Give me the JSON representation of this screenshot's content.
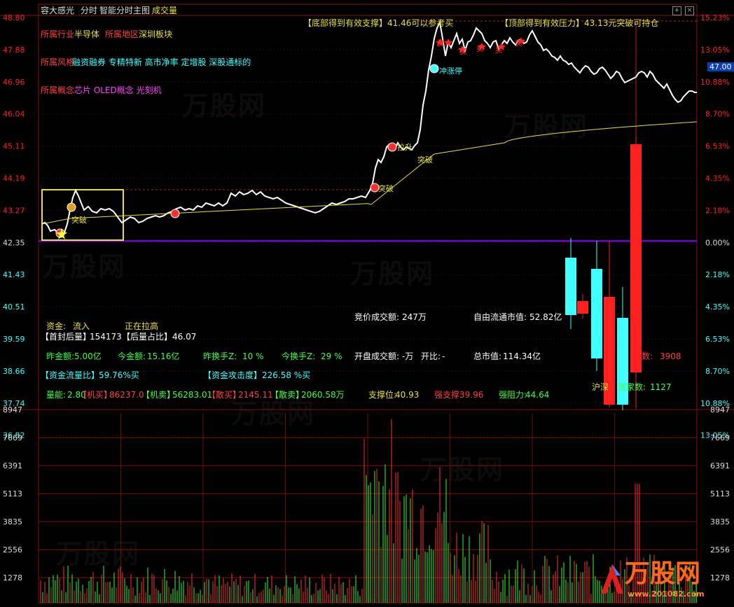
{
  "header": {
    "stock_name": "容大感光",
    "mode": "分时",
    "main_chart": "智能分时主图",
    "indicator": "成交量",
    "btn_add": "+",
    "btn_close": "×"
  },
  "y_price": [
    "48.80",
    "47.88",
    "46.96",
    "46.04",
    "45.11",
    "44.19",
    "43.27",
    "42.35",
    "41.43",
    "40.51",
    "39.59",
    "38.66",
    "37.74",
    "36.82"
  ],
  "y_pct": [
    "15.23%",
    "13.05%",
    "10.88%",
    "8.70%",
    "6.53%",
    "4.35%",
    "2.18%",
    "0.00%",
    "2.18%",
    "4.35%",
    "6.53%",
    "8.70%",
    "10.88%",
    "13.05%"
  ],
  "y_vol_left": [
    "8947",
    "7669",
    "6391",
    "5113",
    "3835",
    "2556",
    "1278"
  ],
  "y_vol_right": [
    "8947",
    "7669",
    "6391",
    "5113",
    "3835",
    "2556",
    "1278"
  ],
  "current_price_box": "47.00",
  "info": {
    "industry_label": "所属行业",
    "industry": "半导体",
    "region_label": "所属地区",
    "region": "深圳板块",
    "style_label": "所属风格",
    "style": "融资融券 专精特新 高市净率 定增股 深股通标的",
    "concept_label": "所属概念",
    "concept": "芯片 OLED概念 光刻机"
  },
  "annotations": {
    "support_top": "【底部得到有效支撑】41.46可以参考买",
    "pressure_top": "【顶部得到有效压力】43.13元突破可持仓",
    "breakout1": "突破",
    "breakout2": "突破",
    "breakout3": "突破",
    "pullup": "拉升",
    "limit_up": "冲涨停",
    "sell_marks": [
      "卖",
      "卖",
      "卖",
      "卖",
      "卖"
    ],
    "buy_marks": [
      "买"
    ]
  },
  "stats": {
    "fund_label": "资金:",
    "fund_value": "流入",
    "status": "正在拉高",
    "first_seal_label": "【首封后量】",
    "first_seal_value": "154173",
    "after_ratio_label": "【后量占比】",
    "after_ratio_value": "46.07",
    "auction_label": "竞价成交额:",
    "auction_value": "247万",
    "float_cap_label": "自由流通市值:",
    "float_cap_value": "52.82亿",
    "prev_amount_label": "昨金额:",
    "prev_amount_value": "5.00亿",
    "today_amount_label": "今金额:",
    "today_amount_value": "15.16亿",
    "prev_turnover_label": "昨换手Z:",
    "prev_turnover_value": "10 %",
    "today_turnover_label": "今换手Z:",
    "today_turnover_value": "29 %",
    "open_amount_label": "开盘成交额:",
    "open_amount_value": "-万",
    "open_ratio_label": "开比:",
    "open_ratio_value": "-",
    "total_cap_label": "总市值:",
    "total_cap_value": "114.34亿",
    "fund_flow_label": "【资金流量比】",
    "fund_flow_value": "59.76%买",
    "fund_attack_label": "【资金攻击度】",
    "fund_attack_value": "226.58 %买",
    "fall_count_label": "数:",
    "fall_count_value": "3908",
    "volume_energy_label": "量能:",
    "volume_energy_value": "2.80",
    "inst_buy_label": "【机买】",
    "inst_buy_value": "86237.0",
    "inst_sell_label": "【机卖】",
    "inst_sell_value": "56283.01",
    "retail_buy_label": "【散买】",
    "retail_buy_value": "2145.11",
    "retail_sell_label": "【散卖】",
    "retail_sell_value": "2060.58万",
    "support_label": "支撑位:",
    "support_value": "40.93",
    "strong_support_label": "强支撑:",
    "strong_support_value": "39.96",
    "strong_resist_label": "强阻力:",
    "strong_resist_value": "44.64",
    "hs_label": "沪深",
    "rise_count_label": "涨家数:",
    "rise_count_value": "1127"
  },
  "watermark": "万股网",
  "watermark_url": "www.201082.com",
  "colors": {
    "up": "#ff2020",
    "down": "#40ffff",
    "line": "#ffffff",
    "avg": "#e8e040",
    "zero": "#8000ff",
    "grid": "#7a1010"
  }
}
